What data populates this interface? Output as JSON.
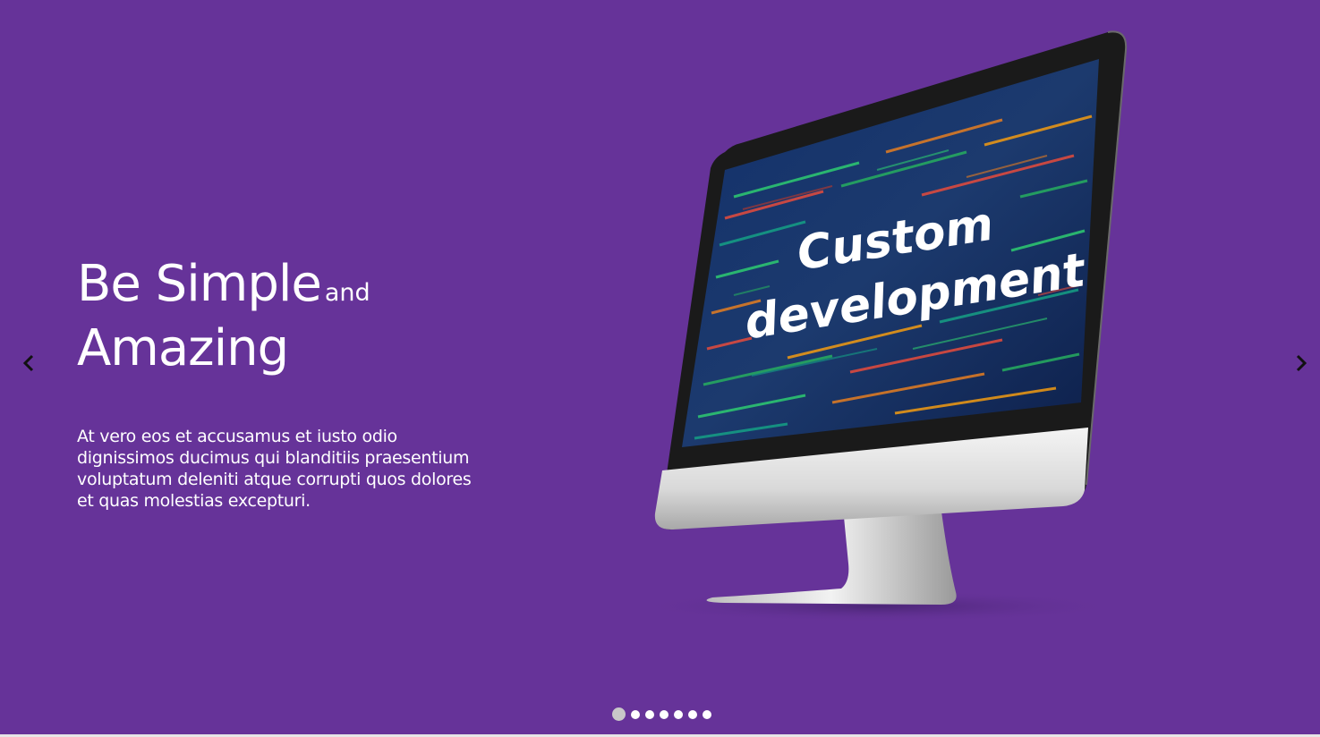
{
  "slide": {
    "headline_part1": "Be Simple",
    "headline_small": "and",
    "headline_part2": "Amazing",
    "description": "At vero eos et accusamus et iusto odio dignissimos ducimus qui blanditiis praesentium voluptatum deleniti atque corrupti quos dolores et quas molestias excepturi.",
    "screen_text_line1": "Custom",
    "screen_text_line2": "development"
  },
  "navigation": {
    "prev_icon": "chevron-left-icon",
    "next_icon": "chevron-right-icon"
  },
  "pagination": {
    "total": 7,
    "active_index": 0
  },
  "colors": {
    "background": "#663399",
    "text": "#ffffff",
    "dot_active": "#c8c8c8",
    "dot": "#ffffff"
  }
}
